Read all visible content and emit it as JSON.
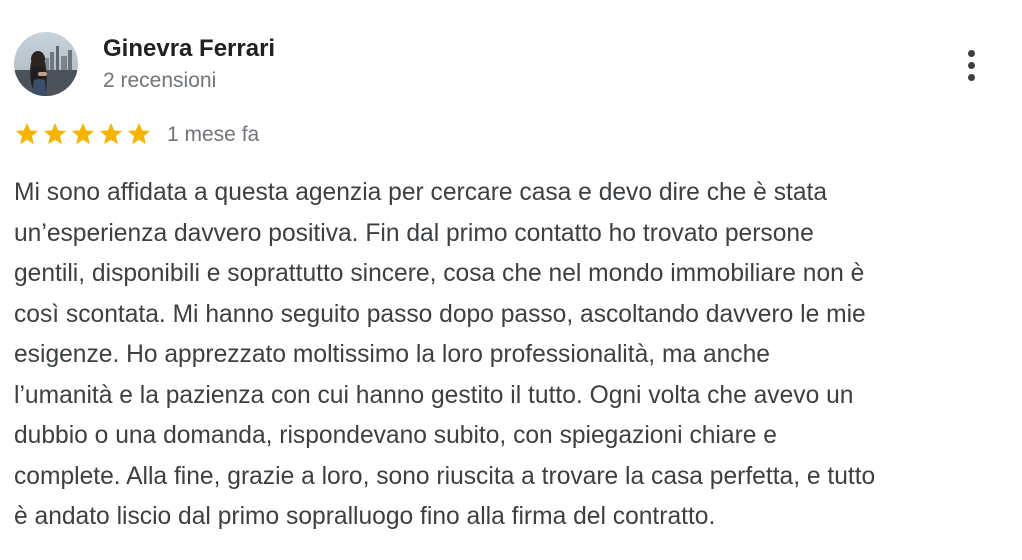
{
  "reviewer": {
    "name": "Ginevra Ferrari",
    "review_count": "2 recensioni"
  },
  "rating": {
    "stars": 5,
    "max_stars": 5,
    "star_color": "#f4b400"
  },
  "review": {
    "date": "1 mese fa",
    "lines": [
      "Mi sono affidata a questa agenzia per cercare casa e devo dire che è stata",
      "un’esperienza davvero positiva. Fin dal primo contatto ho trovato persone",
      "gentili, disponibili e soprattutto sincere, cosa che nel mondo immobiliare non è",
      "così scontata. Mi hanno seguito passo dopo passo, ascoltando davvero le mie",
      "esigenze. Ho apprezzato moltissimo la loro professionalità, ma anche",
      "l’umanità e la pazienza con cui hanno gestito il tutto. Ogni volta che avevo un",
      "dubbio o una domanda, rispondevano subito, con spiegazioni chiare e",
      "complete. Alla fine, grazie a loro, sono riuscita a trovare la casa perfetta, e tutto",
      "è andato liscio dal primo sopralluogo fino alla firma del contratto."
    ]
  },
  "icons": {
    "more": "more-vert-icon",
    "star": "star-icon",
    "avatar": "avatar-photo"
  },
  "colors": {
    "name": "#202124",
    "secondary": "#70757a",
    "body_text": "#3c4043"
  }
}
